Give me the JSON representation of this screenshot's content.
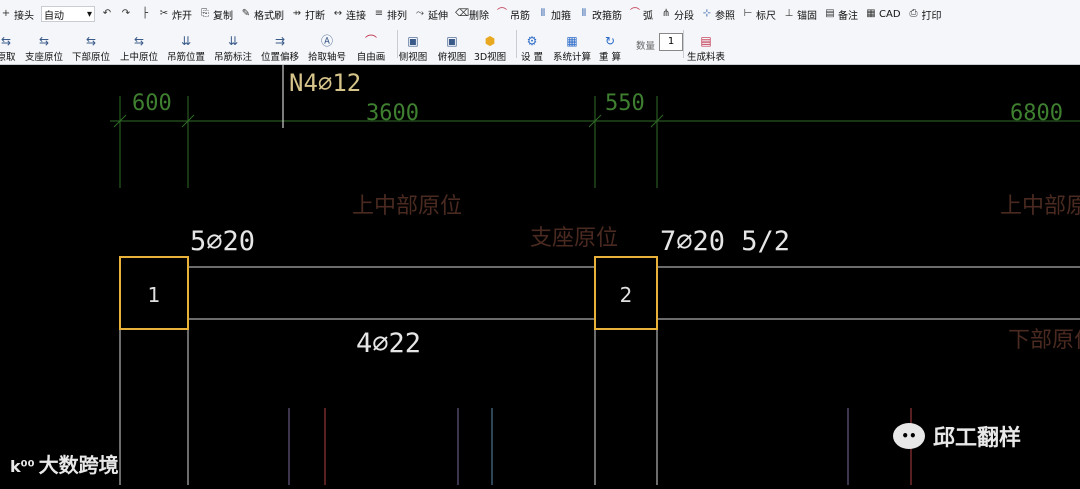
{
  "toolbar": {
    "row1": [
      {
        "icon": "+",
        "label": "接头",
        "key": "joint"
      },
      {
        "select": true,
        "label": "自动",
        "key": "mode"
      },
      {
        "icon": "↶",
        "label": "",
        "key": "undo"
      },
      {
        "icon": "↷",
        "label": "",
        "key": "redo"
      },
      {
        "icon": "├",
        "label": "",
        "key": "dim"
      },
      {
        "icon": "✂",
        "label": "炸开",
        "key": "explode"
      },
      {
        "icon": "⎘",
        "label": "复制",
        "key": "copy"
      },
      {
        "icon": "✎",
        "label": "格式刷",
        "key": "format"
      },
      {
        "icon": "⇸",
        "label": "打断",
        "key": "break"
      },
      {
        "icon": "↔",
        "label": "连接",
        "key": "connect"
      },
      {
        "icon": "≡",
        "label": "排列",
        "key": "arrange"
      },
      {
        "icon": "⤳",
        "label": "延伸",
        "key": "extend"
      },
      {
        "icon": "⌫",
        "label": "删除",
        "key": "delete"
      },
      {
        "icon": "⌒",
        "label": "吊筋",
        "key": "hanger"
      },
      {
        "icon": "⦀",
        "label": "加箍",
        "key": "addstirrup"
      },
      {
        "icon": "⦀",
        "label": "改箍筋",
        "key": "editstirrup"
      },
      {
        "icon": "⌒",
        "label": "弧",
        "key": "arc"
      },
      {
        "icon": "⋔",
        "label": "分段",
        "key": "segment"
      },
      {
        "icon": "⊹",
        "label": "参照",
        "key": "reference"
      },
      {
        "icon": "⊢",
        "label": "标尺",
        "key": "ruler"
      },
      {
        "icon": "⊥",
        "label": "锚固",
        "key": "anchor"
      },
      {
        "icon": "▤",
        "label": "备注",
        "key": "note"
      },
      {
        "icon": "▦",
        "label": "CAD",
        "key": "cad"
      },
      {
        "icon": "⎙",
        "label": "打印",
        "key": "print"
      }
    ],
    "row2": [
      {
        "label": "原取",
        "icon": "⇆",
        "key": "orig"
      },
      {
        "label": "支座原位",
        "icon": "⇆",
        "key": "support"
      },
      {
        "label": "下部原位",
        "icon": "⇆",
        "key": "bottom"
      },
      {
        "label": "上中原位",
        "icon": "⇆",
        "key": "topmid"
      },
      {
        "label": "吊筋位置",
        "icon": "⇊",
        "key": "hangerpos"
      },
      {
        "label": "吊筋标注",
        "icon": "⇊",
        "key": "hangerdim"
      },
      {
        "label": "位置偏移",
        "icon": "⇉",
        "key": "offset"
      },
      {
        "label": "拾取轴号",
        "icon": "Ⓐ",
        "key": "pickaxis"
      },
      {
        "label": "自由画",
        "icon": "⌒",
        "key": "freedraw"
      },
      {
        "label": "侧视图",
        "icon": "▣",
        "key": "sideview"
      },
      {
        "label": "俯视图",
        "icon": "▣",
        "key": "topview"
      },
      {
        "label": "3D视图",
        "icon": "⬢",
        "key": "view3d"
      },
      {
        "label": "设 置",
        "icon": "⚙",
        "key": "settings"
      },
      {
        "label": "系统计算",
        "icon": "▦",
        "key": "calc"
      },
      {
        "label": "重 算",
        "icon": "↻",
        "key": "recalc"
      },
      {
        "label": "生成料表",
        "icon": "▤",
        "key": "gen"
      }
    ],
    "qty_label": "数量",
    "qty_value": "1"
  },
  "drawing": {
    "label_n": "N4⌀12",
    "dim_600": "600",
    "dim_3600": "3600",
    "dim_550": "550",
    "dim_6800": "6800",
    "top_left": "5⌀20",
    "top_right": "7⌀20  5/2",
    "bottom": "4⌀22",
    "col1": "1",
    "col2": "2",
    "ghost_top_mid": "上中部原位",
    "ghost_support": "支座原位",
    "ghost_top_mid_right": "上中部原位",
    "ghost_bottom_right": "下部原位"
  },
  "colors": {
    "dim": "#3a7a2a",
    "dimtext": "#3f7f30",
    "beam": "#d8d8d8",
    "column": "#e8b13a",
    "ghost": "#5a3a2a"
  },
  "watermark": {
    "left": "大数跨境",
    "right": "邱工翻样"
  }
}
